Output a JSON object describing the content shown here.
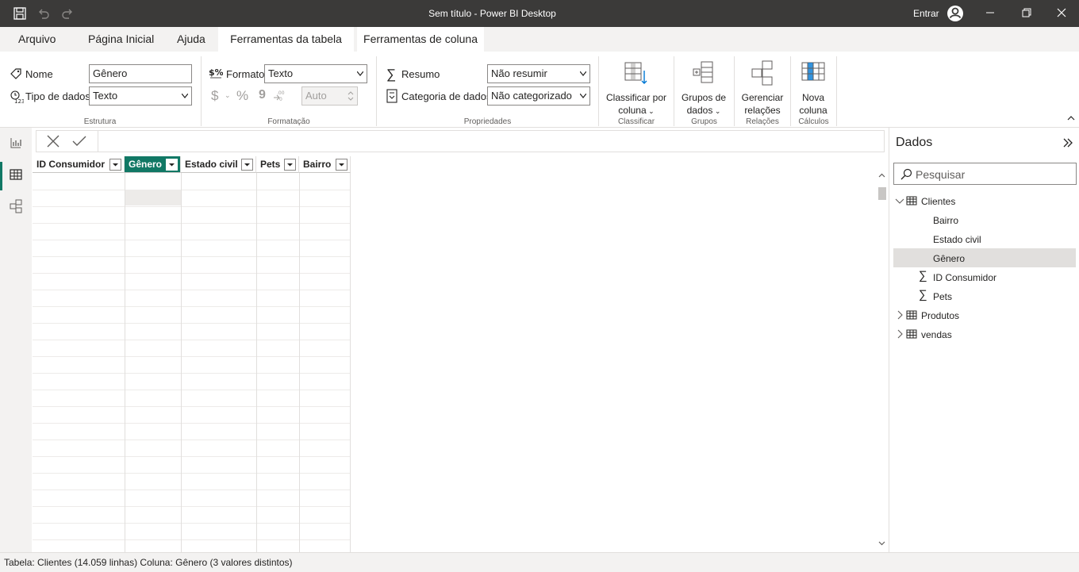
{
  "window": {
    "title": "Sem título - Power BI Desktop",
    "signin": "Entrar"
  },
  "tabs": [
    {
      "label": "Arquivo"
    },
    {
      "label": "Página Inicial"
    },
    {
      "label": "Ajuda"
    },
    {
      "label": "Ferramentas da tabela"
    },
    {
      "label": "Ferramentas de coluna"
    }
  ],
  "ribbon": {
    "estrutura": {
      "name_label": "Nome",
      "name_value": "Gênero",
      "type_label": "Tipo de dados",
      "type_value": "Texto",
      "group_label": "Estrutura"
    },
    "formatacao": {
      "format_label": "Formato",
      "format_value": "Texto",
      "auto_value": "Auto",
      "group_label": "Formatação"
    },
    "propriedades": {
      "summary_label": "Resumo",
      "summary_value": "Não resumir",
      "category_label": "Categoria de dados",
      "category_value": "Não categorizado",
      "group_label": "Propriedades"
    },
    "classificar": {
      "line1": "Classificar por",
      "line2": "coluna",
      "group_label": "Classificar"
    },
    "grupos": {
      "line1": "Grupos de",
      "line2": "dados",
      "group_label": "Grupos"
    },
    "relacoes": {
      "line1": "Gerenciar",
      "line2": "relações",
      "group_label": "Relações"
    },
    "calculos": {
      "line1": "Nova",
      "line2": "coluna",
      "group_label": "Cálculos"
    }
  },
  "table": {
    "columns": [
      "ID Consumidor",
      "Gênero",
      "Estado civil",
      "Pets",
      "Bairro"
    ],
    "selected_column": "Gênero"
  },
  "data_pane": {
    "title": "Dados",
    "search_placeholder": "Pesquisar",
    "tables": [
      {
        "name": "Clientes",
        "fields": [
          "Bairro",
          "Estado civil",
          "Gênero",
          "ID Consumidor",
          "Pets"
        ]
      },
      {
        "name": "Produtos"
      },
      {
        "name": "vendas"
      }
    ]
  },
  "status": {
    "text": "Tabela: Clientes (14.059 linhas) Coluna: Gênero (3 valores distintos)"
  },
  "colors": {
    "accent": "#117865",
    "titlebar": "#3b3a39"
  }
}
